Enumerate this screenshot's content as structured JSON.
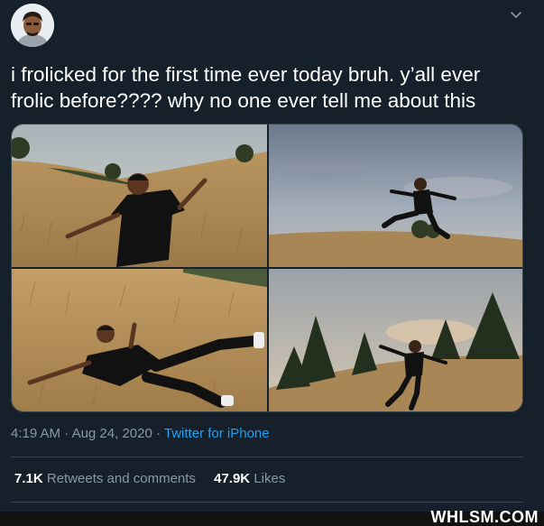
{
  "tweet": {
    "avatar_icon": "user-avatar",
    "menu_icon": "chevron-down-icon",
    "text": "i frolicked for the first time ever today bruh. y’all ever frolic before???? why no one ever tell me about this",
    "media": [
      {
        "alt": "man in black outfit posing with arms outstretched on golden grassy hillside"
      },
      {
        "alt": "man leaping mid-air above golden field under cloudy sky"
      },
      {
        "alt": "man lying back in tall dry grass with arms spread"
      },
      {
        "alt": "man running downhill with arms out near tall pine trees"
      }
    ],
    "time": "4:19 AM",
    "separator1": "·",
    "date": "Aug 24, 2020",
    "separator2": "·",
    "source": "Twitter for iPhone",
    "stats": {
      "retweets_count": "7.1K",
      "retweets_label": "Retweets and comments",
      "likes_count": "47.9K",
      "likes_label": "Likes"
    }
  },
  "watermark": "WHLSM.COM",
  "colors": {
    "background": "#15202b",
    "text_primary": "#ffffff",
    "text_secondary": "#8899a6",
    "link": "#1da1f2",
    "divider": "#38444d"
  }
}
